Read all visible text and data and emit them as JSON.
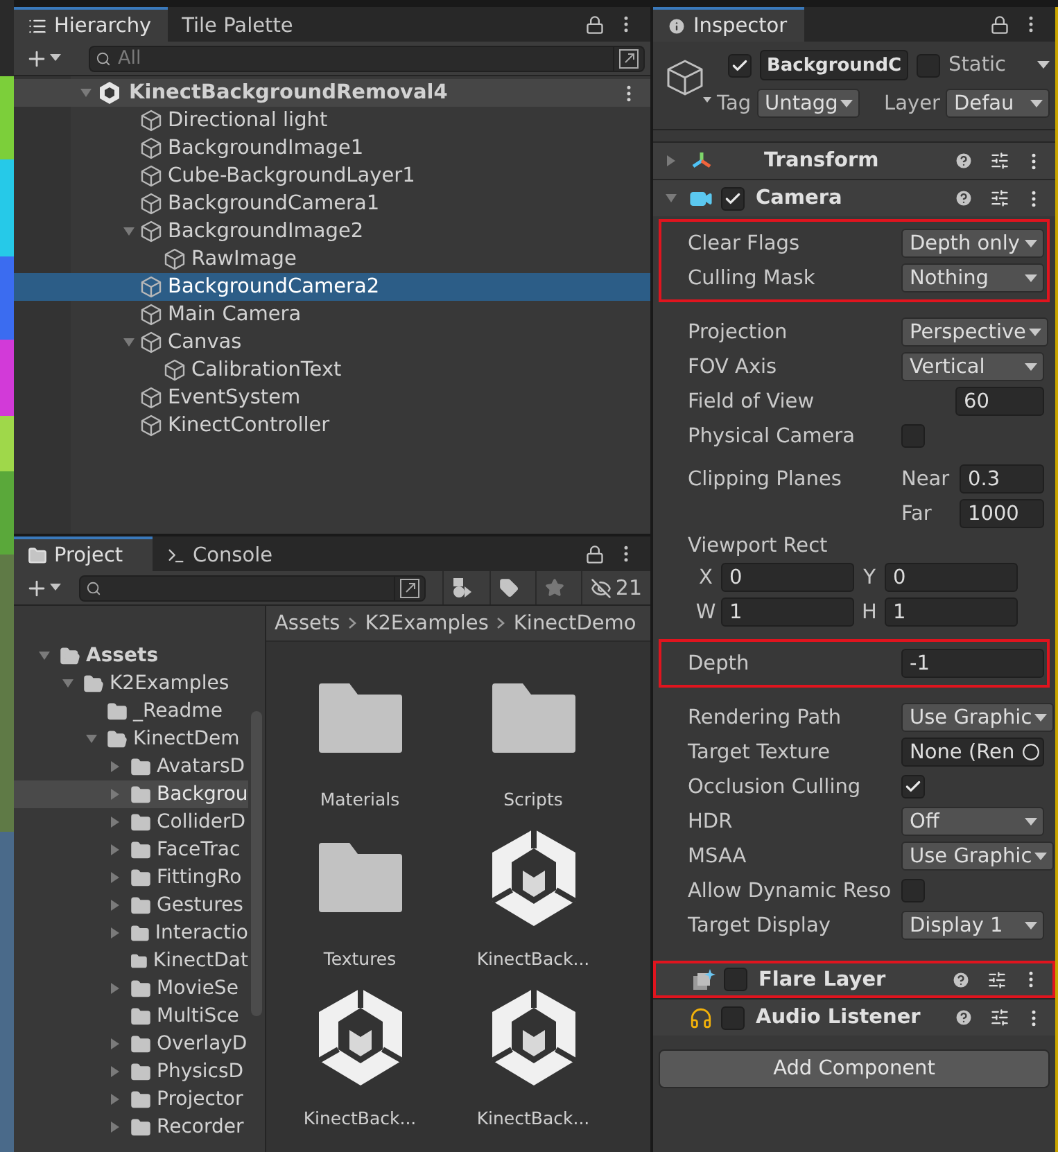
{
  "hierarchy": {
    "tabs": [
      {
        "label": "Hierarchy",
        "kind": "hierarchy",
        "selected": true
      },
      {
        "label": "Tile Palette",
        "kind": "palette",
        "selected": false
      }
    ],
    "search": {
      "placeholder": "All"
    },
    "scene": {
      "name": "KinectBackgroundRemoval4",
      "expanded": true,
      "children": [
        {
          "name": "Directional light",
          "selected": false
        },
        {
          "name": "BackgroundImage1",
          "selected": false
        },
        {
          "name": "Cube-BackgroundLayer1",
          "selected": false
        },
        {
          "name": "BackgroundCamera1",
          "selected": false
        },
        {
          "name": "BackgroundImage2",
          "selected": false,
          "expanded": true,
          "children": [
            {
              "name": "RawImage",
              "selected": false
            }
          ]
        },
        {
          "name": "BackgroundCamera2",
          "selected": true
        },
        {
          "name": "Main Camera",
          "selected": false
        },
        {
          "name": "Canvas",
          "selected": false,
          "expanded": true,
          "children": [
            {
              "name": "CalibrationText",
              "selected": false
            }
          ]
        },
        {
          "name": "EventSystem",
          "selected": false
        },
        {
          "name": "KinectController",
          "selected": false
        }
      ]
    }
  },
  "project": {
    "tabs": [
      {
        "label": "Project",
        "kind": "project",
        "selected": true
      },
      {
        "label": "Console",
        "kind": "console",
        "selected": false
      }
    ],
    "hidden_count": "21",
    "tree": [
      {
        "name": "Assets",
        "expanded": true,
        "selected": false,
        "children": [
          {
            "name": "K2Examples",
            "expanded": true,
            "selected": false,
            "children": [
              {
                "name": "_Readme",
                "selected": false
              },
              {
                "name": "KinectDem",
                "expanded": true,
                "selected": false,
                "children": [
                  {
                    "name": "AvatarsD",
                    "expanded": false,
                    "selected": false
                  },
                  {
                    "name": "Backgrou",
                    "expanded": false,
                    "selected": true
                  },
                  {
                    "name": "ColliderD",
                    "expanded": false,
                    "selected": false
                  },
                  {
                    "name": "FaceTrac",
                    "expanded": false,
                    "selected": false
                  },
                  {
                    "name": "FittingRo",
                    "expanded": false,
                    "selected": false
                  },
                  {
                    "name": "Gestures",
                    "expanded": false,
                    "selected": false
                  },
                  {
                    "name": "Interactio",
                    "expanded": false,
                    "selected": false
                  },
                  {
                    "name": "KinectDat",
                    "selected": false
                  },
                  {
                    "name": "MovieSe",
                    "expanded": false,
                    "selected": false
                  },
                  {
                    "name": "MultiSce",
                    "selected": false
                  },
                  {
                    "name": "OverlayD",
                    "expanded": false,
                    "selected": false
                  },
                  {
                    "name": "PhysicsD",
                    "expanded": false,
                    "selected": false
                  },
                  {
                    "name": "Projector",
                    "expanded": false,
                    "selected": false
                  },
                  {
                    "name": "Recorder",
                    "expanded": false,
                    "selected": false
                  }
                ]
              }
            ]
          }
        ]
      }
    ],
    "breadcrumb": [
      "Assets",
      "K2Examples",
      "KinectDemo"
    ],
    "assets": [
      {
        "name": "Materials",
        "kind": "folder"
      },
      {
        "name": "Scripts",
        "kind": "folder"
      },
      {
        "name": "Textures",
        "kind": "folder"
      },
      {
        "name": "KinectBack...",
        "kind": "scene"
      },
      {
        "name": "KinectBack...",
        "kind": "scene"
      },
      {
        "name": "KinectBack...",
        "kind": "scene"
      }
    ]
  },
  "inspector": {
    "tab": "Inspector",
    "object": {
      "active": true,
      "name": "BackgroundC",
      "static": false,
      "static_label": "Static",
      "tag_label": "Tag",
      "tag": "Untagg",
      "layer_label": "Layer",
      "layer": "Defau"
    },
    "components": [
      {
        "name": "Transform",
        "kind": "transform",
        "expanded": false,
        "highlighted": false
      },
      {
        "name": "Camera",
        "kind": "camera",
        "expanded": true,
        "enabled": true,
        "highlighted": false,
        "groups": [
          {
            "highlighted": true,
            "rows": [
              {
                "kind": "dropdown",
                "label": "Clear Flags",
                "value": "Depth only"
              },
              {
                "kind": "dropdown",
                "label": "Culling Mask",
                "value": "Nothing"
              }
            ]
          },
          {
            "highlighted": false,
            "rows": [
              {
                "kind": "dropdown",
                "label": "Projection",
                "value": "Perspective"
              },
              {
                "kind": "dropdown",
                "label": "FOV Axis",
                "value": "Vertical"
              },
              {
                "kind": "number",
                "label": "Field of View",
                "value": "60"
              },
              {
                "kind": "checkbox",
                "label": "Physical Camera",
                "checked": false
              },
              {
                "kind": "clip",
                "label": "Clipping Planes",
                "near_label": "Near",
                "near": "0.3",
                "far_label": "Far",
                "far": "1000"
              },
              {
                "kind": "rect",
                "label": "Viewport Rect",
                "fields": [
                  {
                    "label": "X",
                    "value": "0"
                  },
                  {
                    "label": "Y",
                    "value": "0"
                  },
                  {
                    "label": "W",
                    "value": "1"
                  },
                  {
                    "label": "H",
                    "value": "1"
                  }
                ]
              }
            ]
          },
          {
            "highlighted": true,
            "rows": [
              {
                "kind": "field",
                "label": "Depth",
                "value": "-1"
              }
            ]
          },
          {
            "highlighted": false,
            "rows": [
              {
                "kind": "dropdown",
                "label": "Rendering Path",
                "value": "Use Graphic"
              },
              {
                "kind": "object",
                "label": "Target Texture",
                "value": "None (Ren"
              },
              {
                "kind": "checkbox",
                "label": "Occlusion Culling",
                "checked": true
              },
              {
                "kind": "dropdown",
                "label": "HDR",
                "value": "Off"
              },
              {
                "kind": "dropdown",
                "label": "MSAA",
                "value": "Use Graphic"
              },
              {
                "kind": "checkbox",
                "label": "Allow Dynamic Reso",
                "checked": false
              },
              {
                "kind": "dropdown",
                "label": "Target Display",
                "value": "Display 1"
              }
            ]
          }
        ]
      },
      {
        "name": "Flare Layer",
        "kind": "flare",
        "enabled": false,
        "highlighted": true
      },
      {
        "name": "Audio Listener",
        "kind": "audio",
        "enabled": false,
        "highlighted": false
      }
    ],
    "add_button": "Add Component"
  }
}
